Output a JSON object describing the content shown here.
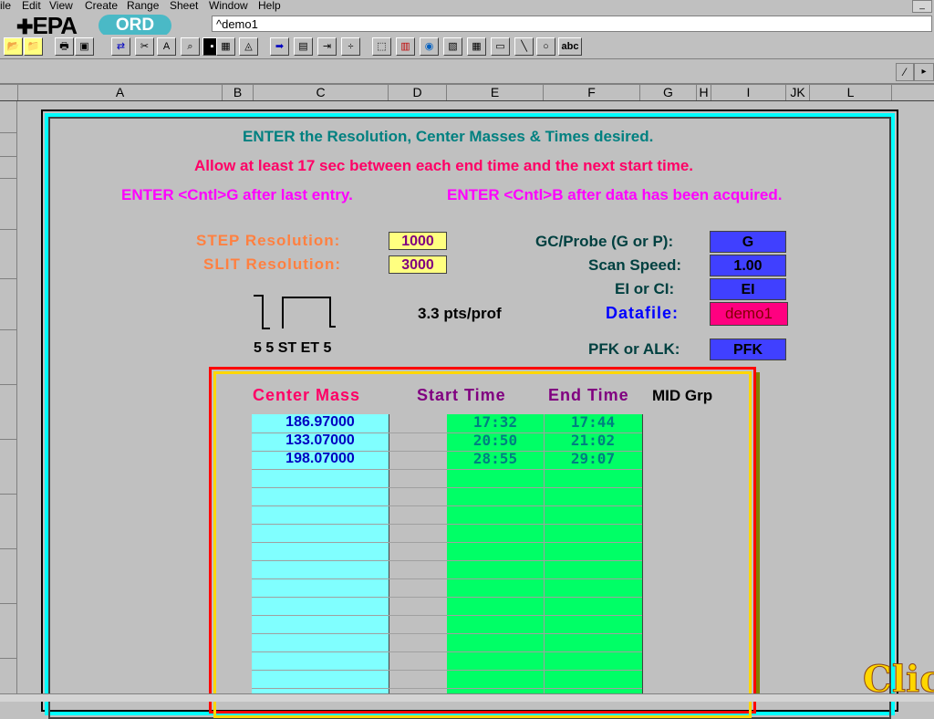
{
  "menu": {
    "items": [
      "ile",
      "Edit",
      "View",
      "Create",
      "Range",
      "Sheet",
      "Window",
      "Help"
    ],
    "minimize": "_"
  },
  "logos": {
    "epa": "EPA",
    "ord": "ORD"
  },
  "namebox": {
    "value": "^demo1"
  },
  "toolbar": {
    "icons": [
      "open-folder-icon",
      "open-icon",
      "print-icon",
      "preview-icon",
      "transpose-icon",
      "cut-icon",
      "text-icon",
      "find-icon",
      "cell-icon",
      "chart-icon",
      "arrow-right-icon",
      "format-icon",
      "insert-icon",
      "fraction-icon",
      "select-icon",
      "bar-chart-icon",
      "globe-icon",
      "map-icon",
      "table-icon",
      "rect-icon",
      "line-icon",
      "ellipse-icon",
      "textbox-icon"
    ],
    "abc_label": "abc"
  },
  "columns": [
    "A",
    "B",
    "C",
    "D",
    "E",
    "F",
    "G",
    "H",
    "I",
    "JK",
    "L"
  ],
  "instructions": {
    "line1": "ENTER the Resolution, Center Masses & Times desired.",
    "line2": "Allow at least 17 sec between each end time and the next start time.",
    "line3a": "ENTER <Cntl>G after last entry.",
    "line3b": "ENTER <Cntl>B after data has been acquired."
  },
  "resolution": {
    "step_label": "STEP Resolution:",
    "step_value": "1000",
    "slit_label": "SLIT Resolution:",
    "slit_value": "3000"
  },
  "settings": {
    "gc_label": "GC/Probe (G or P):",
    "gc_value": "G",
    "scan_label": "Scan Speed:",
    "scan_value": "1.00",
    "ei_label": "EI or CI:",
    "ei_value": "EI",
    "datafile_label": "Datafile:",
    "datafile_value": "demo1",
    "pfk_label": "PFK or ALK:",
    "pfk_value": "PFK"
  },
  "timing": {
    "pts_label": "3.3 pts/prof",
    "legend": "5 5 ST  ET 5"
  },
  "table": {
    "headers": {
      "center_mass": "Center Mass",
      "start_time": "Start Time",
      "end_time": "End Time",
      "mid_grp": "MID Grp"
    },
    "rows": [
      {
        "mass": "186.97000",
        "start": "17:32",
        "end": "17:44"
      },
      {
        "mass": "133.07000",
        "start": "20:50",
        "end": "21:02"
      },
      {
        "mass": "198.07000",
        "start": "28:55",
        "end": "29:07"
      }
    ]
  },
  "click_button": "Click",
  "colors": {
    "teal": "#008080",
    "magenta": "#ff0066",
    "pink": "#ff00ff",
    "orange": "#ff8040",
    "yellow_cell": "#ffff80",
    "blue_cell": "#4040ff",
    "purple": "#800080",
    "datafile_blue": "#0000ff"
  }
}
